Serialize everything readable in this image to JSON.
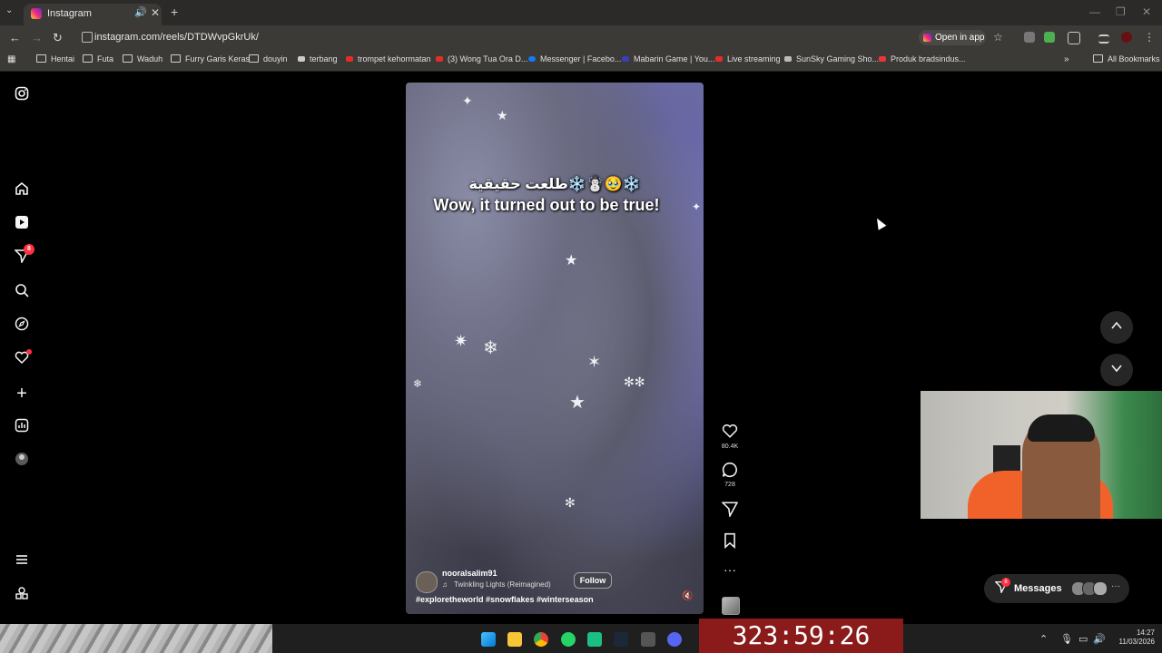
{
  "browser": {
    "tab_title": "Instagram",
    "url": "instagram.com/reels/DTDWvpGkrUk/",
    "open_in_app": "Open in app",
    "bookmarks": [
      "Hentai",
      "Futa",
      "Waduh",
      "Furry Garis Keras",
      "douyin",
      "terbang",
      "trompet kehormatan",
      "(3) Wong Tua Ora D...",
      "Messenger | Facebo...",
      "Mabarin Game | You...",
      "Live streaming",
      "SunSky Gaming Sho...",
      "Produk bradsindus..."
    ],
    "all_bookmarks": "All Bookmarks"
  },
  "sidebar": {
    "notifications_badge": "8"
  },
  "reel": {
    "caption_arabic": "طلعت حقيقية❄️☃️🥹❄️",
    "caption_english": "Wow, it turned out to be true!",
    "author": "nooralsalim91",
    "song": "Twinkling Lights (Reimagined)",
    "follow_label": "Follow",
    "hashtags": "#exploretheworld #snowflakes #winterseason",
    "likes": "80.4K",
    "comments": "728"
  },
  "messages": {
    "label": "Messages",
    "badge": "8"
  },
  "overlay": {
    "timer": "323:59:26"
  },
  "taskbar": {
    "time": "14:27",
    "date": "11/03/2026"
  }
}
